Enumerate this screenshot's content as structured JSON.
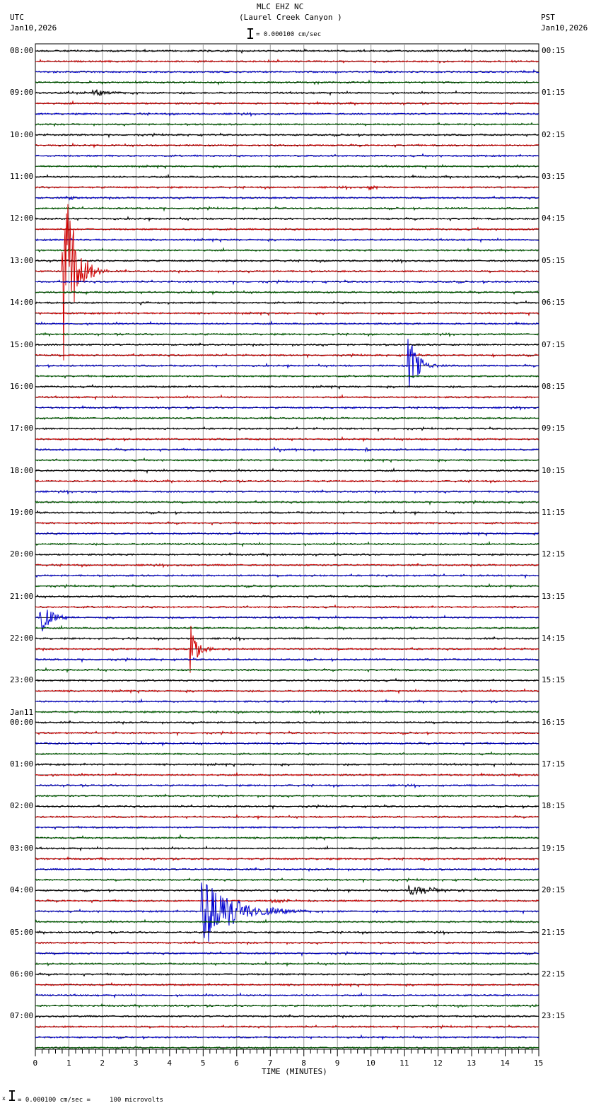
{
  "header": {
    "station": "MLC EHZ NC",
    "location": "(Laurel Creek Canyon )",
    "scale": "= 0.000100 cm/sec",
    "left_tz": "UTC",
    "left_date": "Jan10,2026",
    "right_tz": "PST",
    "right_date": "Jan10,2026"
  },
  "footer": {
    "scale": "= 0.000100 cm/sec =     100 microvolts",
    "mark": "x"
  },
  "chart_data": {
    "type": "line",
    "title": "MLC EHZ NC (Laurel Creek Canyon )",
    "xlabel": "TIME (MINUTES)",
    "xlim": [
      0,
      15
    ],
    "x_ticks": [
      "0",
      "1",
      "2",
      "3",
      "4",
      "5",
      "6",
      "7",
      "8",
      "9",
      "10",
      "11",
      "12",
      "13",
      "14",
      "15"
    ],
    "traces_per_hour": 4,
    "trace_minutes": 15,
    "trace_colors": [
      "#000000",
      "#d00000",
      "#0000d0",
      "#006000"
    ],
    "date_change_label": "Jan11",
    "left_labels": [
      "08:00",
      "09:00",
      "10:00",
      "11:00",
      "12:00",
      "13:00",
      "14:00",
      "15:00",
      "16:00",
      "17:00",
      "18:00",
      "19:00",
      "20:00",
      "21:00",
      "22:00",
      "23:00",
      "00:00",
      "01:00",
      "02:00",
      "03:00",
      "04:00",
      "05:00",
      "06:00",
      "07:00"
    ],
    "right_labels": [
      "00:15",
      "01:15",
      "02:15",
      "03:15",
      "04:15",
      "05:15",
      "06:15",
      "07:15",
      "08:15",
      "09:15",
      "10:15",
      "11:15",
      "12:15",
      "13:15",
      "14:15",
      "15:15",
      "16:15",
      "17:15",
      "18:15",
      "19:15",
      "20:15",
      "21:15",
      "22:15",
      "23:15"
    ],
    "events": [
      {
        "trace": 4,
        "minute": 1.7,
        "duration": 0.7,
        "amplitude": 4
      },
      {
        "trace": 13,
        "minute": 9.9,
        "duration": 0.4,
        "amplitude": 4
      },
      {
        "trace": 13,
        "minute": 14.2,
        "duration": 0.2,
        "amplitude": 3
      },
      {
        "trace": 14,
        "minute": 1.0,
        "duration": 0.2,
        "amplitude": 4
      },
      {
        "trace": 21,
        "minute": 0.78,
        "duration": 0.5,
        "amplitude": 150
      },
      {
        "trace": 23,
        "minute": 1.5,
        "duration": 0.1,
        "amplitude": 4
      },
      {
        "trace": 24,
        "minute": 3.1,
        "duration": 0.3,
        "amplitude": 3
      },
      {
        "trace": 29,
        "minute": 13.6,
        "duration": 0.1,
        "amplitude": 3
      },
      {
        "trace": 30,
        "minute": 11.1,
        "duration": 0.4,
        "amplitude": 40
      },
      {
        "trace": 38,
        "minute": 7.1,
        "duration": 0.6,
        "amplitude": 3
      },
      {
        "trace": 38,
        "minute": 9.8,
        "duration": 0.3,
        "amplitude": 3
      },
      {
        "trace": 54,
        "minute": 0.12,
        "duration": 0.4,
        "amplitude": 25
      },
      {
        "trace": 57,
        "minute": 4.6,
        "duration": 0.3,
        "amplitude": 34
      },
      {
        "trace": 75,
        "minute": 4.3,
        "duration": 0.1,
        "amplitude": 4
      },
      {
        "trace": 80,
        "minute": 11.1,
        "duration": 1.1,
        "amplitude": 7
      },
      {
        "trace": 81,
        "minute": 7.0,
        "duration": 0.8,
        "amplitude": 3
      },
      {
        "trace": 82,
        "minute": 4.95,
        "duration": 1.3,
        "amplitude": 45
      }
    ]
  }
}
